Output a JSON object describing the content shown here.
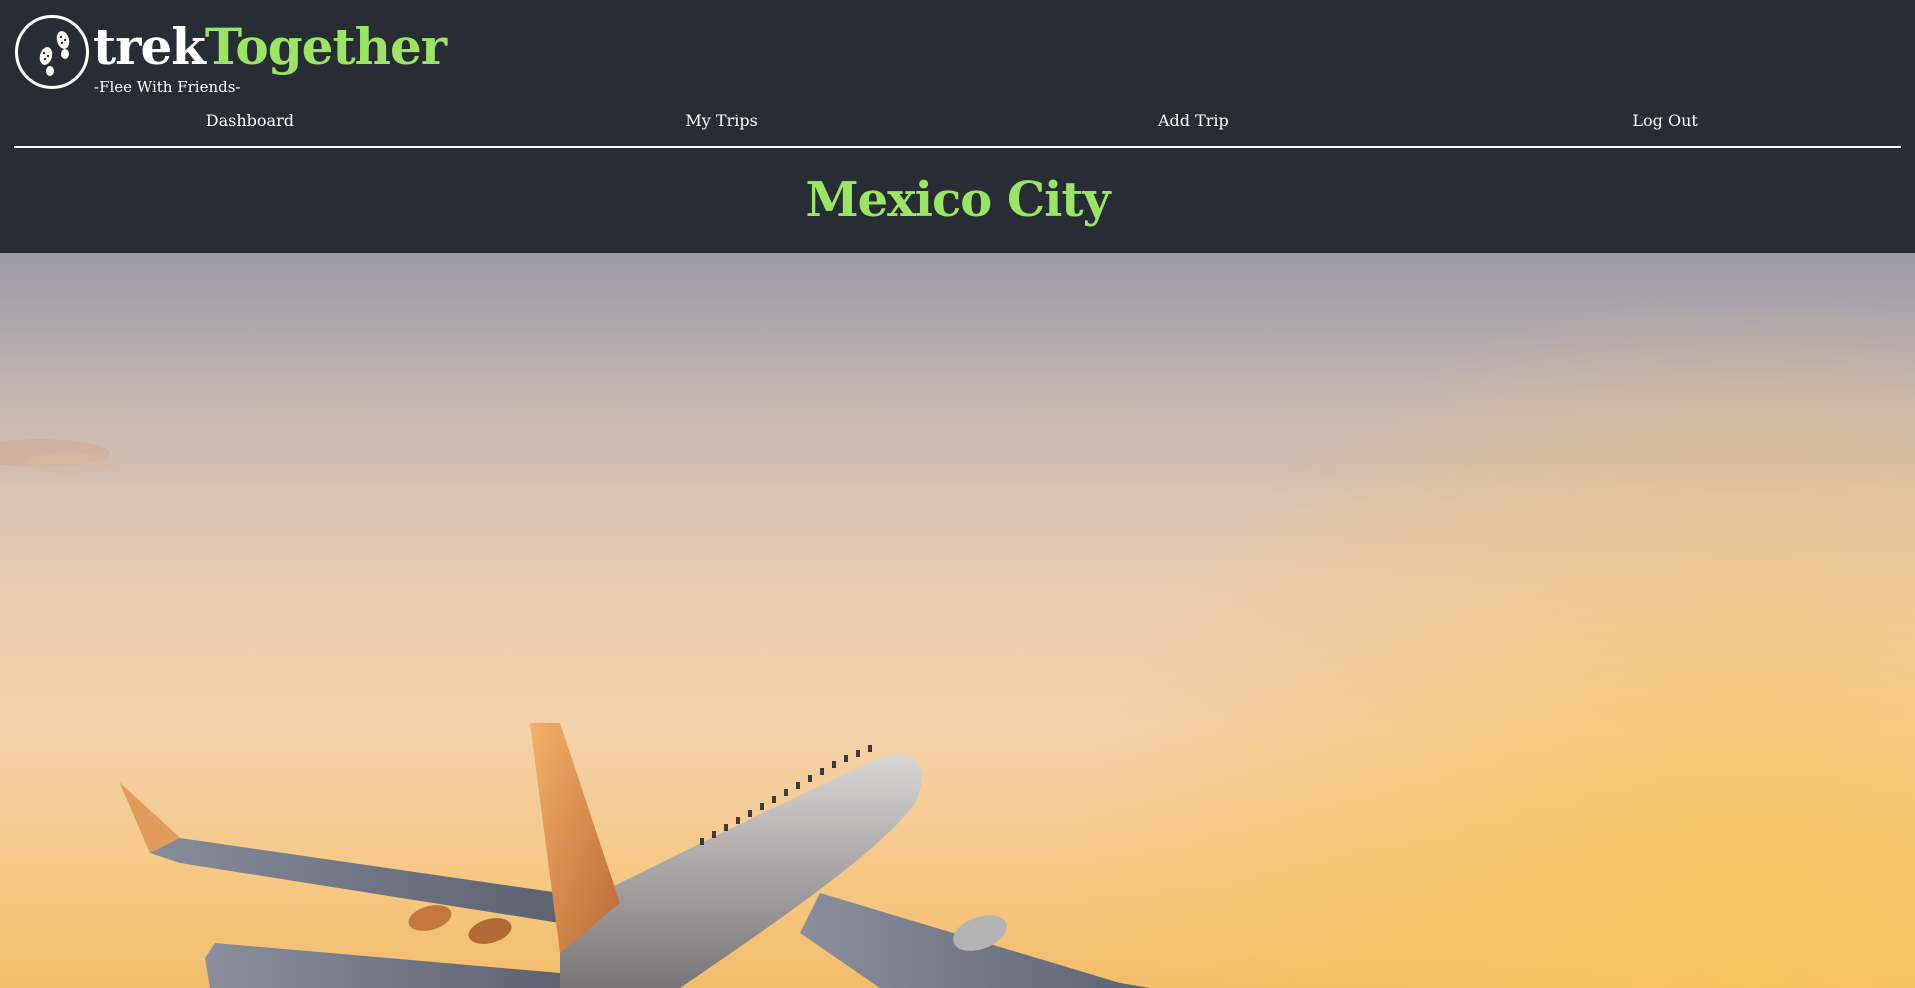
{
  "brand": {
    "name_part1": "trek",
    "name_part2": "Together",
    "tagline": "-Flee With Friends-",
    "logo_icon": "footprints-icon"
  },
  "nav": {
    "items": [
      {
        "label": "Dashboard"
      },
      {
        "label": "My Trips"
      },
      {
        "label": "Add Trip"
      },
      {
        "label": "Log Out"
      }
    ]
  },
  "page": {
    "title": "Mexico City"
  },
  "hero": {
    "image": "airplane-at-sunset"
  },
  "colors": {
    "background": "#282c34",
    "accent": "#9be564",
    "text": "#ffffff"
  }
}
